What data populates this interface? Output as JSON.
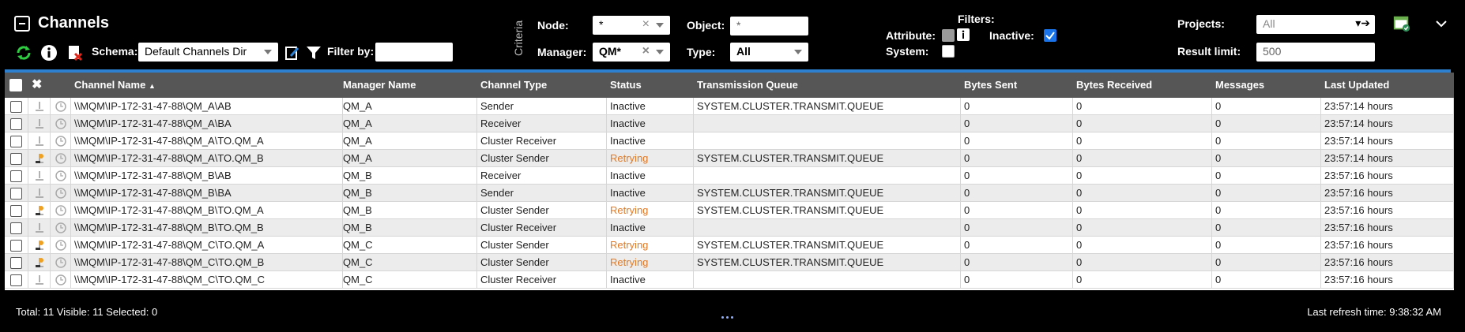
{
  "header": {
    "title": "Channels",
    "schema_label": "Schema:",
    "schema_value": "Default Channels Dir",
    "filter_by_label": "Filter by:",
    "filter_by_value": "",
    "criteria_label": "Criteria",
    "node_label": "Node:",
    "node_value": "*",
    "manager_label": "Manager:",
    "manager_value": "QM*",
    "object_label": "Object:",
    "object_value": "*",
    "type_label": "Type:",
    "type_value": "All",
    "filters_label": "Filters:",
    "attribute_label": "Attribute:",
    "inactive_label": "Inactive:",
    "inactive_checked": true,
    "system_label": "System:",
    "system_checked": false,
    "projects_label": "Projects:",
    "projects_value": "All",
    "result_limit_label": "Result limit:",
    "result_limit_value": "500"
  },
  "table": {
    "columns": [
      "Channel Name",
      "Manager Name",
      "Channel Type",
      "Status",
      "Transmission Queue",
      "Bytes Sent",
      "Bytes Received",
      "Messages",
      "Last Updated"
    ],
    "sort_indicator": "▲",
    "rows": [
      {
        "name": "\\\\MQM\\IP-172-31-47-88\\QM_A\\AB",
        "manager": "QM_A",
        "type": "Sender",
        "status": "Inactive",
        "queue": "SYSTEM.CLUSTER.TRANSMIT.QUEUE",
        "sent": "0",
        "received": "0",
        "messages": "0",
        "updated": "23:57:14 hours"
      },
      {
        "name": "\\\\MQM\\IP-172-31-47-88\\QM_A\\BA",
        "manager": "QM_A",
        "type": "Receiver",
        "status": "Inactive",
        "queue": "",
        "sent": "0",
        "received": "0",
        "messages": "0",
        "updated": "23:57:14 hours"
      },
      {
        "name": "\\\\MQM\\IP-172-31-47-88\\QM_A\\TO.QM_A",
        "manager": "QM_A",
        "type": "Cluster Receiver",
        "status": "Inactive",
        "queue": "",
        "sent": "0",
        "received": "0",
        "messages": "0",
        "updated": "23:57:14 hours"
      },
      {
        "name": "\\\\MQM\\IP-172-31-47-88\\QM_A\\TO.QM_B",
        "manager": "QM_A",
        "type": "Cluster Sender",
        "status": "Retrying",
        "queue": "SYSTEM.CLUSTER.TRANSMIT.QUEUE",
        "sent": "0",
        "received": "0",
        "messages": "0",
        "updated": "23:57:14 hours"
      },
      {
        "name": "\\\\MQM\\IP-172-31-47-88\\QM_B\\AB",
        "manager": "QM_B",
        "type": "Receiver",
        "status": "Inactive",
        "queue": "",
        "sent": "0",
        "received": "0",
        "messages": "0",
        "updated": "23:57:16 hours"
      },
      {
        "name": "\\\\MQM\\IP-172-31-47-88\\QM_B\\BA",
        "manager": "QM_B",
        "type": "Sender",
        "status": "Inactive",
        "queue": "SYSTEM.CLUSTER.TRANSMIT.QUEUE",
        "sent": "0",
        "received": "0",
        "messages": "0",
        "updated": "23:57:16 hours"
      },
      {
        "name": "\\\\MQM\\IP-172-31-47-88\\QM_B\\TO.QM_A",
        "manager": "QM_B",
        "type": "Cluster Sender",
        "status": "Retrying",
        "queue": "SYSTEM.CLUSTER.TRANSMIT.QUEUE",
        "sent": "0",
        "received": "0",
        "messages": "0",
        "updated": "23:57:16 hours"
      },
      {
        "name": "\\\\MQM\\IP-172-31-47-88\\QM_B\\TO.QM_B",
        "manager": "QM_B",
        "type": "Cluster Receiver",
        "status": "Inactive",
        "queue": "",
        "sent": "0",
        "received": "0",
        "messages": "0",
        "updated": "23:57:16 hours"
      },
      {
        "name": "\\\\MQM\\IP-172-31-47-88\\QM_C\\TO.QM_A",
        "manager": "QM_C",
        "type": "Cluster Sender",
        "status": "Retrying",
        "queue": "SYSTEM.CLUSTER.TRANSMIT.QUEUE",
        "sent": "0",
        "received": "0",
        "messages": "0",
        "updated": "23:57:16 hours"
      },
      {
        "name": "\\\\MQM\\IP-172-31-47-88\\QM_C\\TO.QM_B",
        "manager": "QM_C",
        "type": "Cluster Sender",
        "status": "Retrying",
        "queue": "SYSTEM.CLUSTER.TRANSMIT.QUEUE",
        "sent": "0",
        "received": "0",
        "messages": "0",
        "updated": "23:57:16 hours"
      },
      {
        "name": "\\\\MQM\\IP-172-31-47-88\\QM_C\\TO.QM_C",
        "manager": "QM_C",
        "type": "Cluster Receiver",
        "status": "Inactive",
        "queue": "",
        "sent": "0",
        "received": "0",
        "messages": "0",
        "updated": "23:57:16 hours"
      }
    ]
  },
  "footer": {
    "totals": "Total: 11 Visible: 11 Selected: 0",
    "refresh": "Last refresh time: 9:38:32 AM"
  },
  "colors": {
    "accent": "#2d7fd0",
    "retrying": "#e07a26",
    "header_bg": "#565656"
  }
}
